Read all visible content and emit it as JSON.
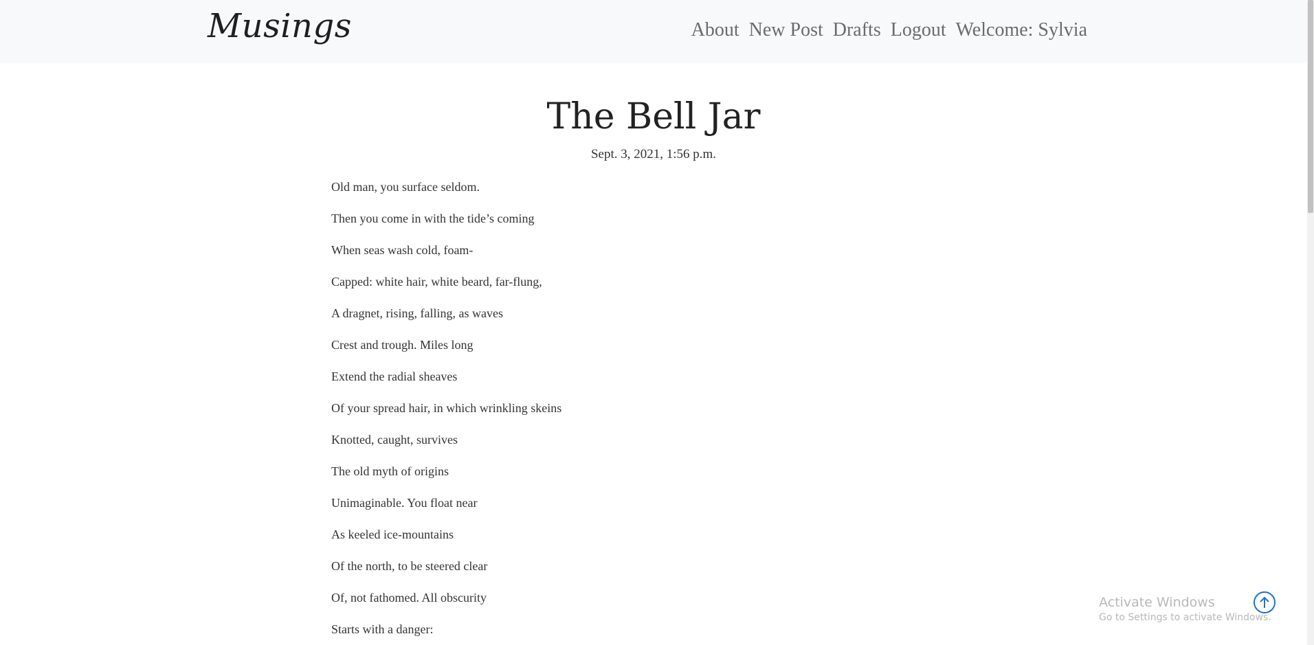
{
  "navbar": {
    "brand": "Musings",
    "links": [
      "About",
      "New Post",
      "Drafts",
      "Logout",
      "Welcome: Sylvia"
    ]
  },
  "post": {
    "title": "The Bell Jar",
    "date": "Sept. 3, 2021, 1:56 p.m.",
    "lines": [
      "Old man, you surface seldom.",
      "Then you come in with the tide’s coming",
      "When seas wash cold, foam-",
      "Capped: white hair, white beard, far-flung,",
      "A dragnet, rising, falling, as waves",
      "Crest and trough. Miles long",
      "Extend the radial sheaves",
      "Of your spread hair, in which wrinkling skeins",
      "Knotted, caught, survives",
      "The old myth of origins",
      "Unimaginable. You float near",
      "As keeled ice-mountains",
      "Of the north, to be steered clear",
      "Of, not fathomed. All obscurity",
      "Starts with a danger:"
    ]
  },
  "watermark": {
    "title": "Activate Windows",
    "subtitle": "Go to Settings to activate Windows."
  },
  "scroll_top": {
    "icon": "arrow-up-circle-icon",
    "color": "#1b73c9"
  }
}
